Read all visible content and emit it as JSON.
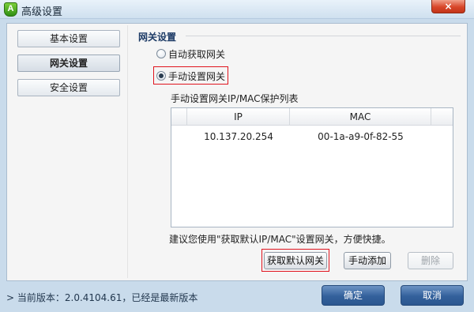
{
  "window": {
    "title": "高级设置",
    "close_glyph": "×"
  },
  "sidebar": {
    "items": [
      {
        "label": "基本设置",
        "active": false
      },
      {
        "label": "网关设置",
        "active": true
      },
      {
        "label": "安全设置",
        "active": false
      }
    ]
  },
  "section": {
    "title": "网关设置"
  },
  "options": {
    "auto_label": "自动获取网关",
    "manual_label": "手动设置网关",
    "selected": "manual"
  },
  "table": {
    "caption": "手动设置网关IP/MAC保护列表",
    "headers": [
      "IP",
      "MAC"
    ],
    "rows": [
      [
        "10.137.20.254",
        "00-1a-a9-0f-82-55"
      ]
    ]
  },
  "hint": "建议您使用\"获取默认IP/MAC\"设置网关，方便快捷。",
  "actions": {
    "get_default": "获取默认网关",
    "manual_add": "手动添加",
    "delete": "删除"
  },
  "footer": {
    "version_text": "> 当前版本：2.0.4104.61，已经是最新版本",
    "ok": "确定",
    "cancel": "取消"
  },
  "colors": {
    "highlight_border": "#e0141e",
    "footer_button": "#33609b"
  }
}
